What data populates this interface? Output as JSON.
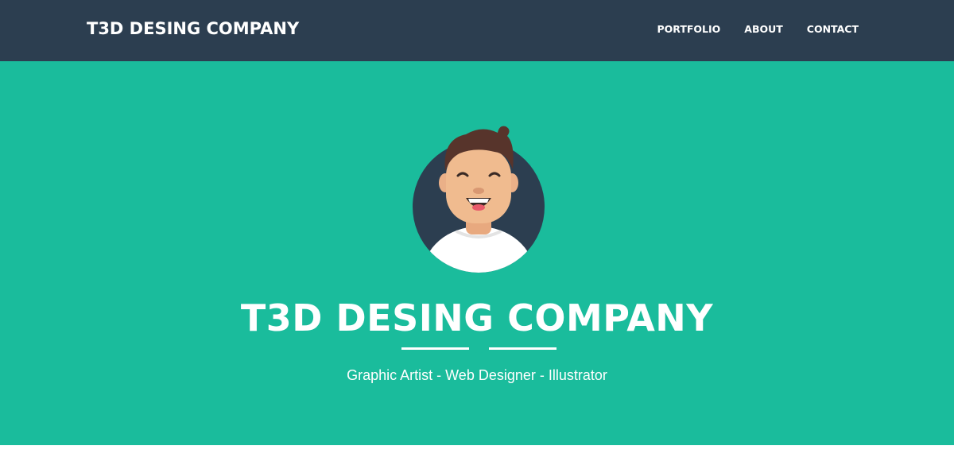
{
  "navbar": {
    "brand": "T3D DESING COMPANY",
    "links": [
      "PORTFOLIO",
      "ABOUT",
      "CONTACT"
    ]
  },
  "hero": {
    "title": "T3D DESING COMPANY",
    "subtitle": "Graphic Artist - Web Designer - Illustrator",
    "avatar_icon": "avatar-illustration-icon",
    "divider_icon": "star-icon"
  },
  "colors": {
    "navbar_bg": "#2c3e50",
    "hero_bg": "#1abc9c",
    "text": "#ffffff"
  }
}
